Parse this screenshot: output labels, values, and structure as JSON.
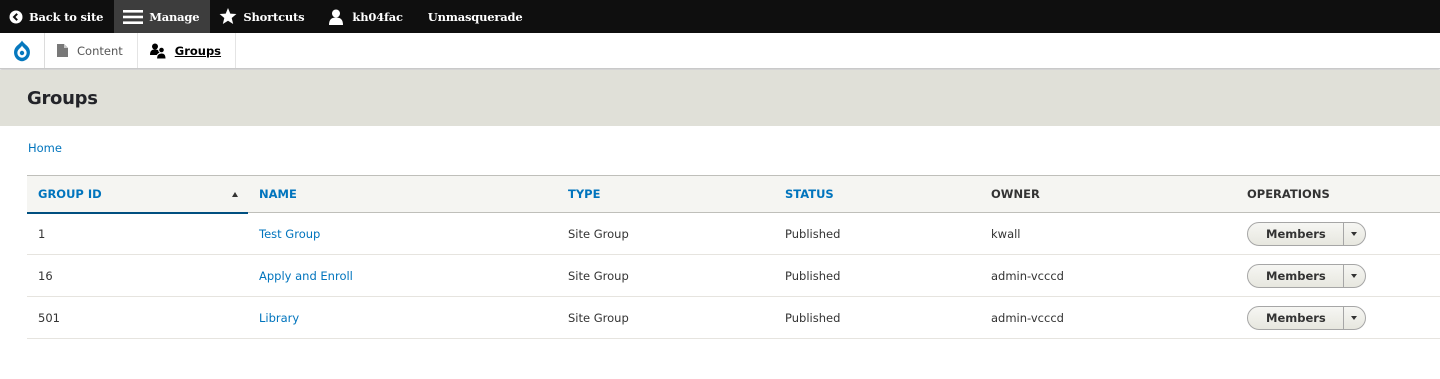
{
  "toolbar": {
    "back_label": "Back to site",
    "manage_label": "Manage",
    "shortcuts_label": "Shortcuts",
    "user_label": "kh04fac",
    "unmasquerade_label": "Unmasquerade"
  },
  "tray": {
    "items": [
      {
        "label": "Content",
        "icon": "page-icon"
      },
      {
        "label": "Groups",
        "icon": "groups-icon"
      }
    ]
  },
  "page": {
    "title": "Groups",
    "breadcrumb": "Home"
  },
  "table": {
    "columns": [
      "GROUP ID",
      "NAME",
      "TYPE",
      "STATUS",
      "OWNER",
      "OPERATIONS"
    ],
    "rows": [
      {
        "id": "1",
        "name": "Test Group",
        "type": "Site Group",
        "status": "Published",
        "owner": "kwall",
        "operation": "Members"
      },
      {
        "id": "16",
        "name": "Apply and Enroll",
        "type": "Site Group",
        "status": "Published",
        "owner": "admin-vcccd",
        "operation": "Members"
      },
      {
        "id": "501",
        "name": "Library",
        "type": "Site Group",
        "status": "Published",
        "owner": "admin-vcccd",
        "operation": "Members"
      }
    ]
  },
  "colors": {
    "link": "#0074bd",
    "toolbar_bg": "#0f0f0f",
    "header_bg": "#e0e0d8"
  }
}
